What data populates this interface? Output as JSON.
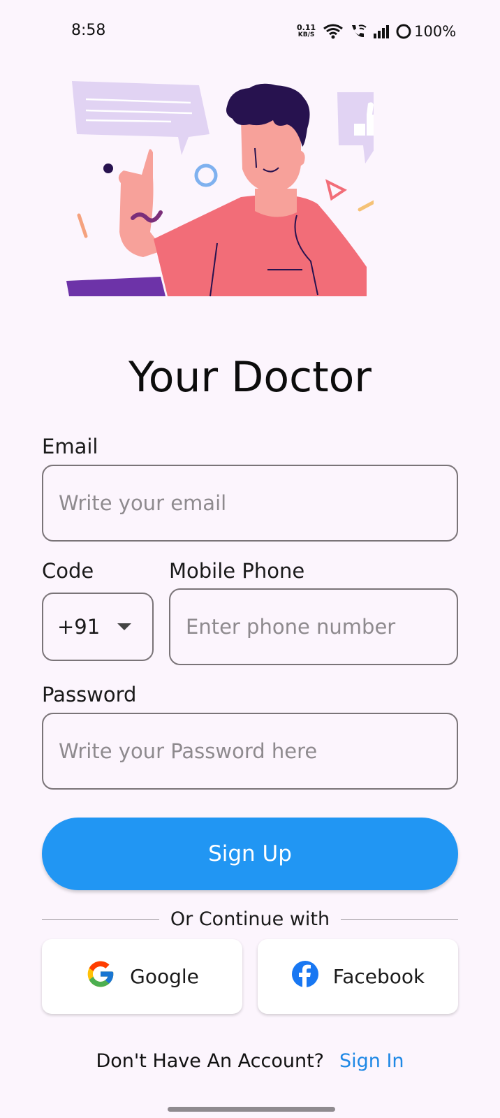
{
  "status_bar": {
    "time": "8:58",
    "net_speed_value": "0.11",
    "net_speed_unit": "KB/S",
    "battery": "100%"
  },
  "title": "Your Doctor",
  "form": {
    "email_label": "Email",
    "email_placeholder": "Write your email",
    "code_label": "Code",
    "code_value": "+91",
    "phone_label": "Mobile Phone",
    "phone_placeholder": "Enter phone number",
    "password_label": "Password",
    "password_placeholder": "Write your Password here",
    "signup_label": "Sign Up"
  },
  "divider_text": "Or Continue with",
  "social": {
    "google_label": "Google",
    "facebook_label": "Facebook"
  },
  "footer": {
    "prompt": "Don't Have An Account?",
    "signin_label": "Sign In"
  },
  "colors": {
    "background": "#fcf5fd",
    "primary": "#2196f3",
    "link": "#1e88e5",
    "shirt": "#f26d78",
    "hair": "#27124f"
  },
  "icons": [
    "wifi-icon",
    "wifi-calling-icon",
    "signal-icon",
    "battery-icon",
    "dropdown-caret-icon",
    "google-icon",
    "facebook-icon"
  ]
}
